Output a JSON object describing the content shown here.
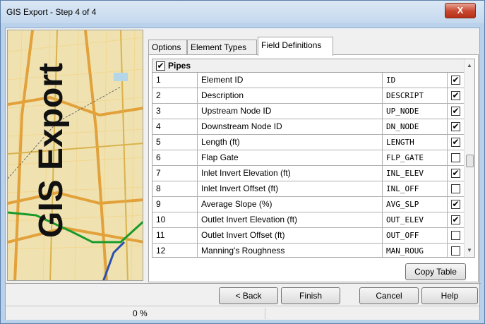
{
  "window": {
    "title": "GIS Export - Step 4 of 4",
    "close_glyph": "X"
  },
  "sidebar": {
    "image_title": "GIS Export"
  },
  "tabs": [
    {
      "label": "Options",
      "active": false
    },
    {
      "label": "Element Types",
      "active": false
    },
    {
      "label": "Field Definitions",
      "active": true
    }
  ],
  "grid": {
    "group": {
      "label": "Pipes",
      "checked": true
    },
    "rows": [
      {
        "num": "1",
        "label": "Element ID",
        "field": "ID",
        "checked": true
      },
      {
        "num": "2",
        "label": "Description",
        "field": "DESCRIPT",
        "checked": true
      },
      {
        "num": "3",
        "label": "Upstream Node ID",
        "field": "UP_NODE",
        "checked": true
      },
      {
        "num": "4",
        "label": "Downstream Node ID",
        "field": "DN_NODE",
        "checked": true
      },
      {
        "num": "5",
        "label": "Length (ft)",
        "field": "LENGTH",
        "checked": true
      },
      {
        "num": "6",
        "label": "Flap Gate",
        "field": "FLP_GATE",
        "checked": false
      },
      {
        "num": "7",
        "label": "Inlet Invert Elevation (ft)",
        "field": "INL_ELEV",
        "checked": true
      },
      {
        "num": "8",
        "label": "Inlet Invert Offset (ft)",
        "field": "INL_OFF",
        "checked": false
      },
      {
        "num": "9",
        "label": "Average Slope (%)",
        "field": "AVG_SLP",
        "checked": true
      },
      {
        "num": "10",
        "label": "Outlet Invert Elevation (ft)",
        "field": "OUT_ELEV",
        "checked": true
      },
      {
        "num": "11",
        "label": "Outlet Invert Offset (ft)",
        "field": "OUT_OFF",
        "checked": false
      },
      {
        "num": "12",
        "label": "Manning's Roughness",
        "field": "MAN_ROUG",
        "checked": false
      }
    ]
  },
  "buttons": {
    "copy_table": "Copy Table",
    "back": "< Back",
    "finish": "Finish",
    "cancel": "Cancel",
    "help": "Help"
  },
  "status": {
    "progress_text": "0 %",
    "progress_value": 0
  },
  "colors": {
    "title_bar": "#c4d8ee",
    "close_button": "#c7452e",
    "map_background": "#efe2b0",
    "road": "#e2a13a",
    "stream": "#1a9a2a"
  }
}
